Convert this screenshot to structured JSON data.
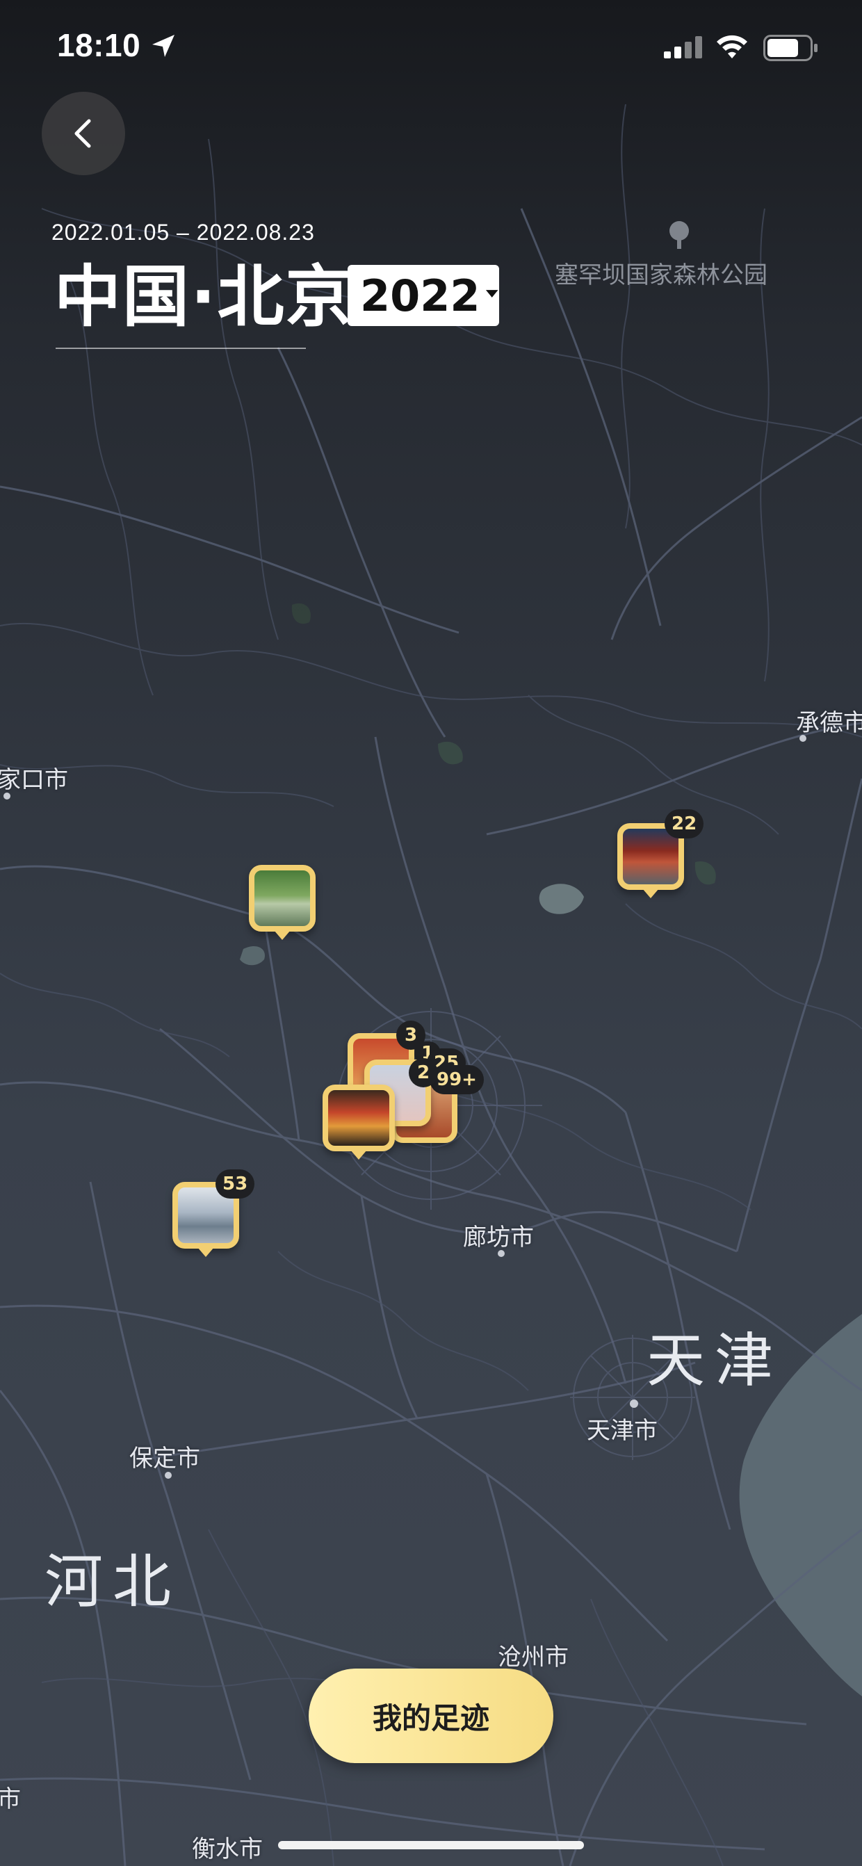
{
  "status_bar": {
    "time": "18:10"
  },
  "header": {
    "date_range": "2022.01.05 – 2022.08.23",
    "title": "中国·北京",
    "year": "2022"
  },
  "map": {
    "labels": {
      "park": "塞罕坝国家森林公园",
      "chengde": "承德市",
      "zhangjiakou": "家口市",
      "langfang": "廊坊市",
      "tianjin_region": "天津",
      "tianjin_city": "天津市",
      "baoding": "保定市",
      "hebei": "河北",
      "cangzhou": "沧州市",
      "hengshui": "衡水市",
      "left_edge_city": "市"
    },
    "clusters": {
      "miyun_count": "22",
      "center_a_count": "3",
      "center_b_count": "1",
      "center_c_count": "25",
      "center_d_count": "2",
      "center_e_count": "99+",
      "southwest_count": "53"
    }
  },
  "footer": {
    "button_label": "我的足迹"
  },
  "icons": {
    "back": "chevron-left-icon",
    "location": "location-arrow-icon",
    "signal": "cellular-signal-icon",
    "wifi": "wifi-icon",
    "battery": "battery-icon",
    "tree": "tree-icon",
    "caret": "caret-down-icon"
  },
  "colors": {
    "pin_border": "#f2cf72",
    "button_gradient_start": "#fff0b0",
    "button_gradient_end": "#f6dc83",
    "badge_text": "#f7e09a"
  }
}
